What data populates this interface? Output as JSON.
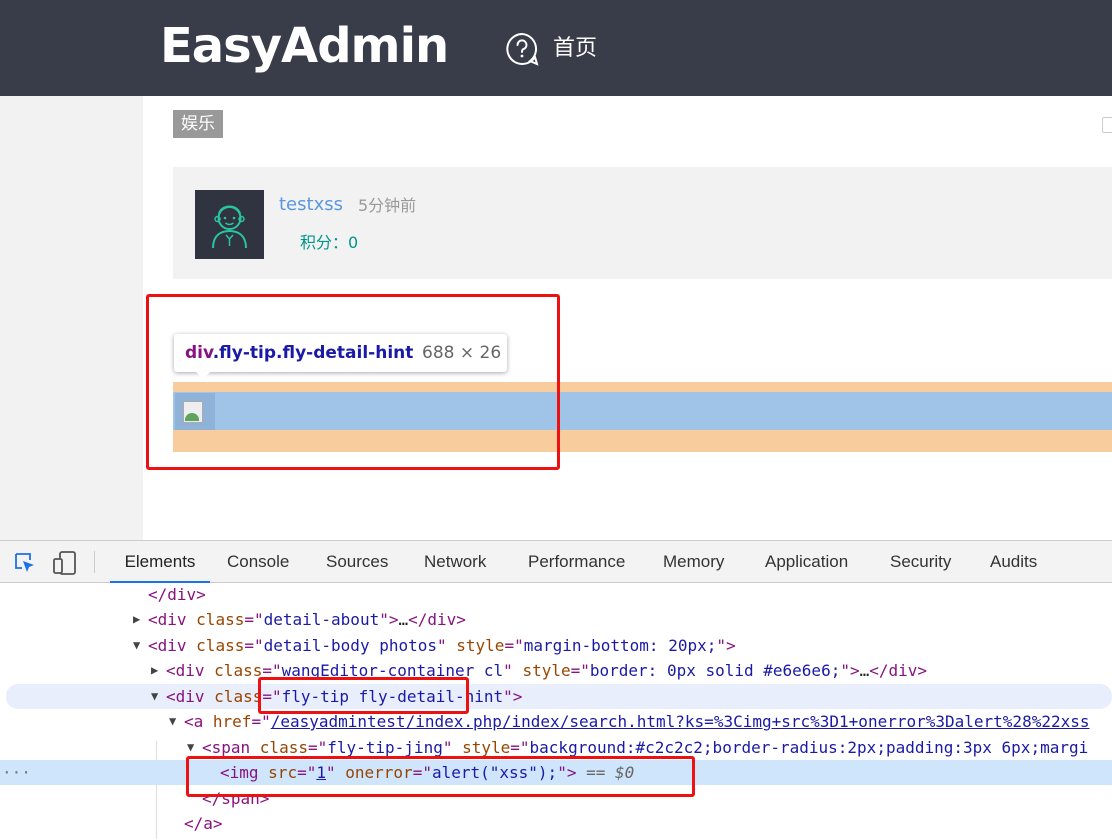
{
  "header": {
    "logo_text": "EasyAdmin",
    "nav_home": "首页",
    "background": "#393d49",
    "icons": [
      "help-circle-icon"
    ]
  },
  "page": {
    "tag_label": "娱乐",
    "author": {
      "username": "testxss",
      "time": "5分钟前",
      "points": "积分：0"
    }
  },
  "inspector_tooltip": {
    "tag": "div",
    "classes": ".fly-tip.fly-detail-hint",
    "size": "688 × 26"
  },
  "devtools": {
    "tabs": [
      "Elements",
      "Console",
      "Sources",
      "Network",
      "Performance",
      "Memory",
      "Application",
      "Security",
      "Audits"
    ],
    "active_tab": "Elements",
    "icons": [
      "inspect-element-icon",
      "device-toolbar-icon"
    ],
    "dom_lines": [
      {
        "text": "</div>"
      },
      {
        "text": "<div class=\"detail-about\">…</div>"
      },
      {
        "text": "<div class=\"detail-body photos\" style=\"margin-bottom: 20px;\">"
      },
      {
        "text": "<div class=\"wangEditor-container cl\" style=\"border: 0px solid #e6e6e6;\">…</div>"
      },
      {
        "text": "<div class=\"fly-tip fly-detail-hint\">"
      },
      {
        "text": "<a href=\"/easyadmintest/index.php/index/search.html?ks=%3Cimg+src%3D1+onerror%3Dalert%28%22xss"
      },
      {
        "text": "<span class=\"fly-tip-jing\" style=\"background:#c2c2c2;border-radius:2px;padding:3px 6px;margi"
      },
      {
        "text": "<img src=\"1\" onerror=\"alert(\"xss\");\"> == $0"
      },
      {
        "text": "</span>"
      },
      {
        "text": "</a>"
      }
    ]
  },
  "colors": {
    "highlight_margin": "#f9cc9d",
    "highlight_content": "#9fc4e7",
    "annotation_red": "#e11111",
    "link_blue": "#5a98de",
    "teal": "#009688"
  }
}
